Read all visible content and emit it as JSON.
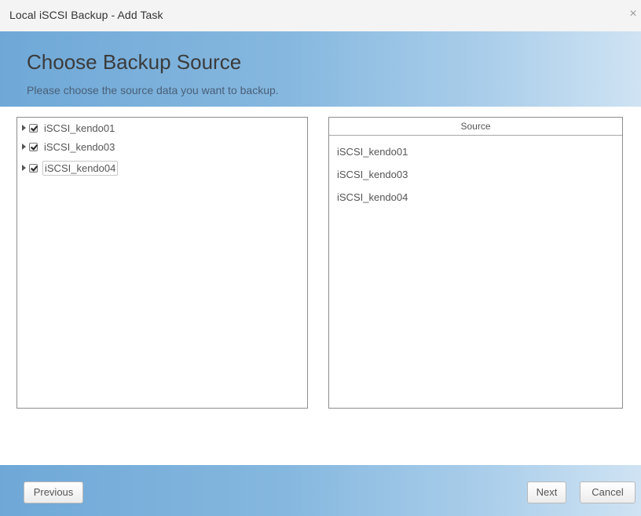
{
  "window": {
    "title": "Local iSCSI Backup - Add Task",
    "close_glyph": "×"
  },
  "banner": {
    "title": "Choose Backup Source",
    "subtitle": "Please choose the source data you want to backup."
  },
  "tree": {
    "items": [
      {
        "label": "iSCSI_kendo01",
        "checked": true,
        "selected": false
      },
      {
        "label": "iSCSI_kendo03",
        "checked": true,
        "selected": false
      },
      {
        "label": "iSCSI_kendo04",
        "checked": true,
        "selected": true
      }
    ]
  },
  "source": {
    "header": "Source",
    "items": [
      "iSCSI_kendo01",
      "iSCSI_kendo03",
      "iSCSI_kendo04"
    ]
  },
  "footer": {
    "previous_label": "Previous",
    "next_label": "Next",
    "cancel_label": "Cancel"
  },
  "icons": {
    "expand": "triangle-right-icon",
    "check": "checkbox-checked-icon",
    "close": "close-icon"
  },
  "colors": {
    "banner_start": "#6fa8d7",
    "banner_end": "#cfe3f3"
  }
}
